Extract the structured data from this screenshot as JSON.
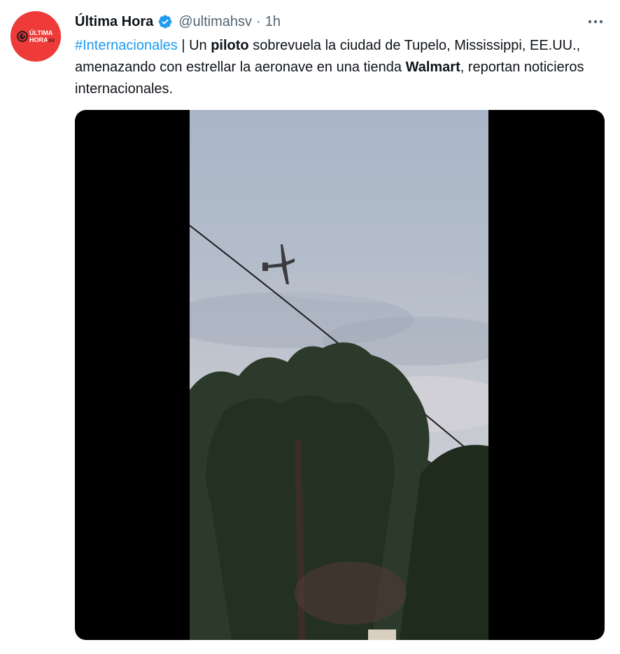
{
  "author": {
    "name": "Última Hora",
    "handle": "@ultimahsv",
    "separator": "·",
    "time": "1h",
    "avatar_text_top": "ÚLTIMA",
    "avatar_text_bottom": "HORA",
    "avatar_text_suffix": ".sv",
    "avatar_color": "#ee3b39"
  },
  "icons": {
    "verified": "verified-badge-icon",
    "more": "more-options-icon"
  },
  "tweet": {
    "hashtag": "#Internacionales",
    "segments": {
      "s1": " | Un ",
      "b1": "piloto",
      "s2": " sobrevuela la ciudad de Tupelo, Mississippi, EE.UU., amenazando con estrellar la aeronave en una tienda ",
      "b2": "Walmart",
      "s3": ", reportan noticieros internacionales."
    }
  },
  "colors": {
    "link": "#1d9bf0",
    "secondary_text": "#536471",
    "verified": "#1d9bf0",
    "media_background": "#000000"
  }
}
